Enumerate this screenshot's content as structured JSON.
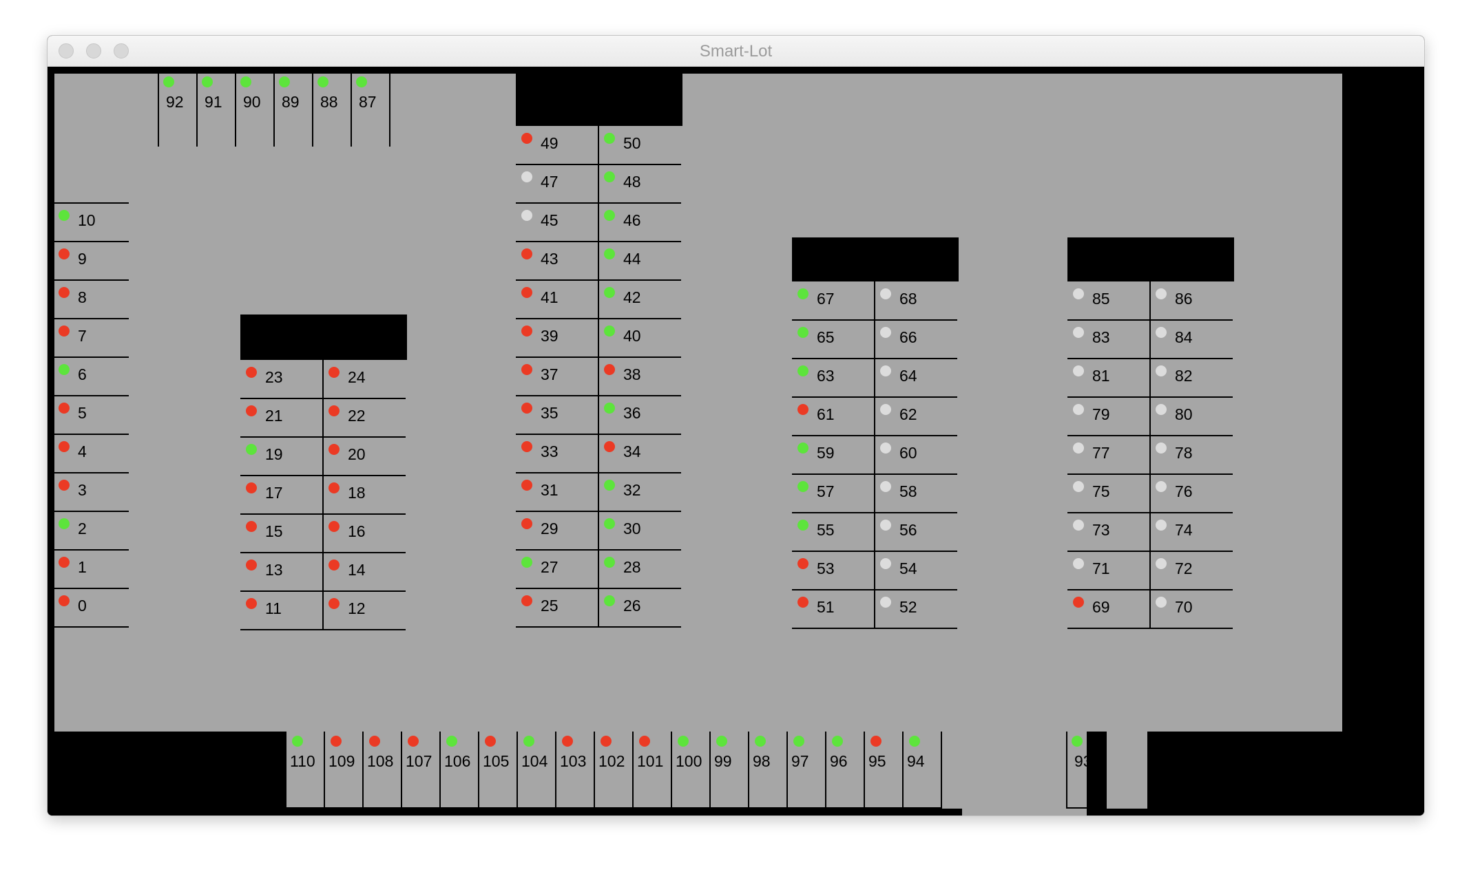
{
  "window": {
    "title": "Smart-Lot"
  },
  "legend_colors": {
    "occupied": "#eb3a24",
    "free": "#5de43c",
    "unknown": "#dcdcdc"
  },
  "spots": [
    {
      "n": "0",
      "s": "occupied"
    },
    {
      "n": "1",
      "s": "occupied"
    },
    {
      "n": "2",
      "s": "free"
    },
    {
      "n": "3",
      "s": "occupied"
    },
    {
      "n": "4",
      "s": "occupied"
    },
    {
      "n": "5",
      "s": "occupied"
    },
    {
      "n": "6",
      "s": "free"
    },
    {
      "n": "7",
      "s": "occupied"
    },
    {
      "n": "8",
      "s": "occupied"
    },
    {
      "n": "9",
      "s": "occupied"
    },
    {
      "n": "10",
      "s": "free"
    },
    {
      "n": "11",
      "s": "occupied"
    },
    {
      "n": "12",
      "s": "occupied"
    },
    {
      "n": "13",
      "s": "occupied"
    },
    {
      "n": "14",
      "s": "occupied"
    },
    {
      "n": "15",
      "s": "occupied"
    },
    {
      "n": "16",
      "s": "occupied"
    },
    {
      "n": "17",
      "s": "occupied"
    },
    {
      "n": "18",
      "s": "occupied"
    },
    {
      "n": "19",
      "s": "free"
    },
    {
      "n": "20",
      "s": "occupied"
    },
    {
      "n": "21",
      "s": "occupied"
    },
    {
      "n": "22",
      "s": "occupied"
    },
    {
      "n": "23",
      "s": "occupied"
    },
    {
      "n": "24",
      "s": "occupied"
    },
    {
      "n": "25",
      "s": "occupied"
    },
    {
      "n": "26",
      "s": "free"
    },
    {
      "n": "27",
      "s": "free"
    },
    {
      "n": "28",
      "s": "free"
    },
    {
      "n": "29",
      "s": "occupied"
    },
    {
      "n": "30",
      "s": "free"
    },
    {
      "n": "31",
      "s": "occupied"
    },
    {
      "n": "32",
      "s": "free"
    },
    {
      "n": "33",
      "s": "occupied"
    },
    {
      "n": "34",
      "s": "occupied"
    },
    {
      "n": "35",
      "s": "occupied"
    },
    {
      "n": "36",
      "s": "free"
    },
    {
      "n": "37",
      "s": "occupied"
    },
    {
      "n": "38",
      "s": "occupied"
    },
    {
      "n": "39",
      "s": "occupied"
    },
    {
      "n": "40",
      "s": "free"
    },
    {
      "n": "41",
      "s": "occupied"
    },
    {
      "n": "42",
      "s": "free"
    },
    {
      "n": "43",
      "s": "occupied"
    },
    {
      "n": "44",
      "s": "free"
    },
    {
      "n": "45",
      "s": "unknown"
    },
    {
      "n": "46",
      "s": "free"
    },
    {
      "n": "47",
      "s": "unknown"
    },
    {
      "n": "48",
      "s": "free"
    },
    {
      "n": "49",
      "s": "occupied"
    },
    {
      "n": "50",
      "s": "free"
    },
    {
      "n": "51",
      "s": "occupied"
    },
    {
      "n": "52",
      "s": "unknown"
    },
    {
      "n": "53",
      "s": "occupied"
    },
    {
      "n": "54",
      "s": "unknown"
    },
    {
      "n": "55",
      "s": "free"
    },
    {
      "n": "56",
      "s": "unknown"
    },
    {
      "n": "57",
      "s": "free"
    },
    {
      "n": "58",
      "s": "unknown"
    },
    {
      "n": "59",
      "s": "free"
    },
    {
      "n": "60",
      "s": "unknown"
    },
    {
      "n": "61",
      "s": "occupied"
    },
    {
      "n": "62",
      "s": "unknown"
    },
    {
      "n": "63",
      "s": "free"
    },
    {
      "n": "64",
      "s": "unknown"
    },
    {
      "n": "65",
      "s": "free"
    },
    {
      "n": "66",
      "s": "unknown"
    },
    {
      "n": "67",
      "s": "free"
    },
    {
      "n": "68",
      "s": "unknown"
    },
    {
      "n": "69",
      "s": "occupied"
    },
    {
      "n": "70",
      "s": "unknown"
    },
    {
      "n": "71",
      "s": "unknown"
    },
    {
      "n": "72",
      "s": "unknown"
    },
    {
      "n": "73",
      "s": "unknown"
    },
    {
      "n": "74",
      "s": "unknown"
    },
    {
      "n": "75",
      "s": "unknown"
    },
    {
      "n": "76",
      "s": "unknown"
    },
    {
      "n": "77",
      "s": "unknown"
    },
    {
      "n": "78",
      "s": "unknown"
    },
    {
      "n": "79",
      "s": "unknown"
    },
    {
      "n": "80",
      "s": "unknown"
    },
    {
      "n": "81",
      "s": "unknown"
    },
    {
      "n": "82",
      "s": "unknown"
    },
    {
      "n": "83",
      "s": "unknown"
    },
    {
      "n": "84",
      "s": "unknown"
    },
    {
      "n": "85",
      "s": "unknown"
    },
    {
      "n": "86",
      "s": "unknown"
    },
    {
      "n": "87",
      "s": "free"
    },
    {
      "n": "88",
      "s": "free"
    },
    {
      "n": "89",
      "s": "free"
    },
    {
      "n": "90",
      "s": "free"
    },
    {
      "n": "91",
      "s": "free"
    },
    {
      "n": "92",
      "s": "free"
    },
    {
      "n": "93",
      "s": "free"
    },
    {
      "n": "94",
      "s": "free"
    },
    {
      "n": "95",
      "s": "occupied"
    },
    {
      "n": "96",
      "s": "free"
    },
    {
      "n": "97",
      "s": "free"
    },
    {
      "n": "98",
      "s": "free"
    },
    {
      "n": "99",
      "s": "free"
    },
    {
      "n": "100",
      "s": "free"
    },
    {
      "n": "101",
      "s": "occupied"
    },
    {
      "n": "102",
      "s": "occupied"
    },
    {
      "n": "103",
      "s": "occupied"
    },
    {
      "n": "104",
      "s": "free"
    },
    {
      "n": "105",
      "s": "occupied"
    },
    {
      "n": "106",
      "s": "free"
    },
    {
      "n": "107",
      "s": "occupied"
    },
    {
      "n": "108",
      "s": "occupied"
    },
    {
      "n": "109",
      "s": "occupied"
    },
    {
      "n": "110",
      "s": "free"
    }
  ]
}
